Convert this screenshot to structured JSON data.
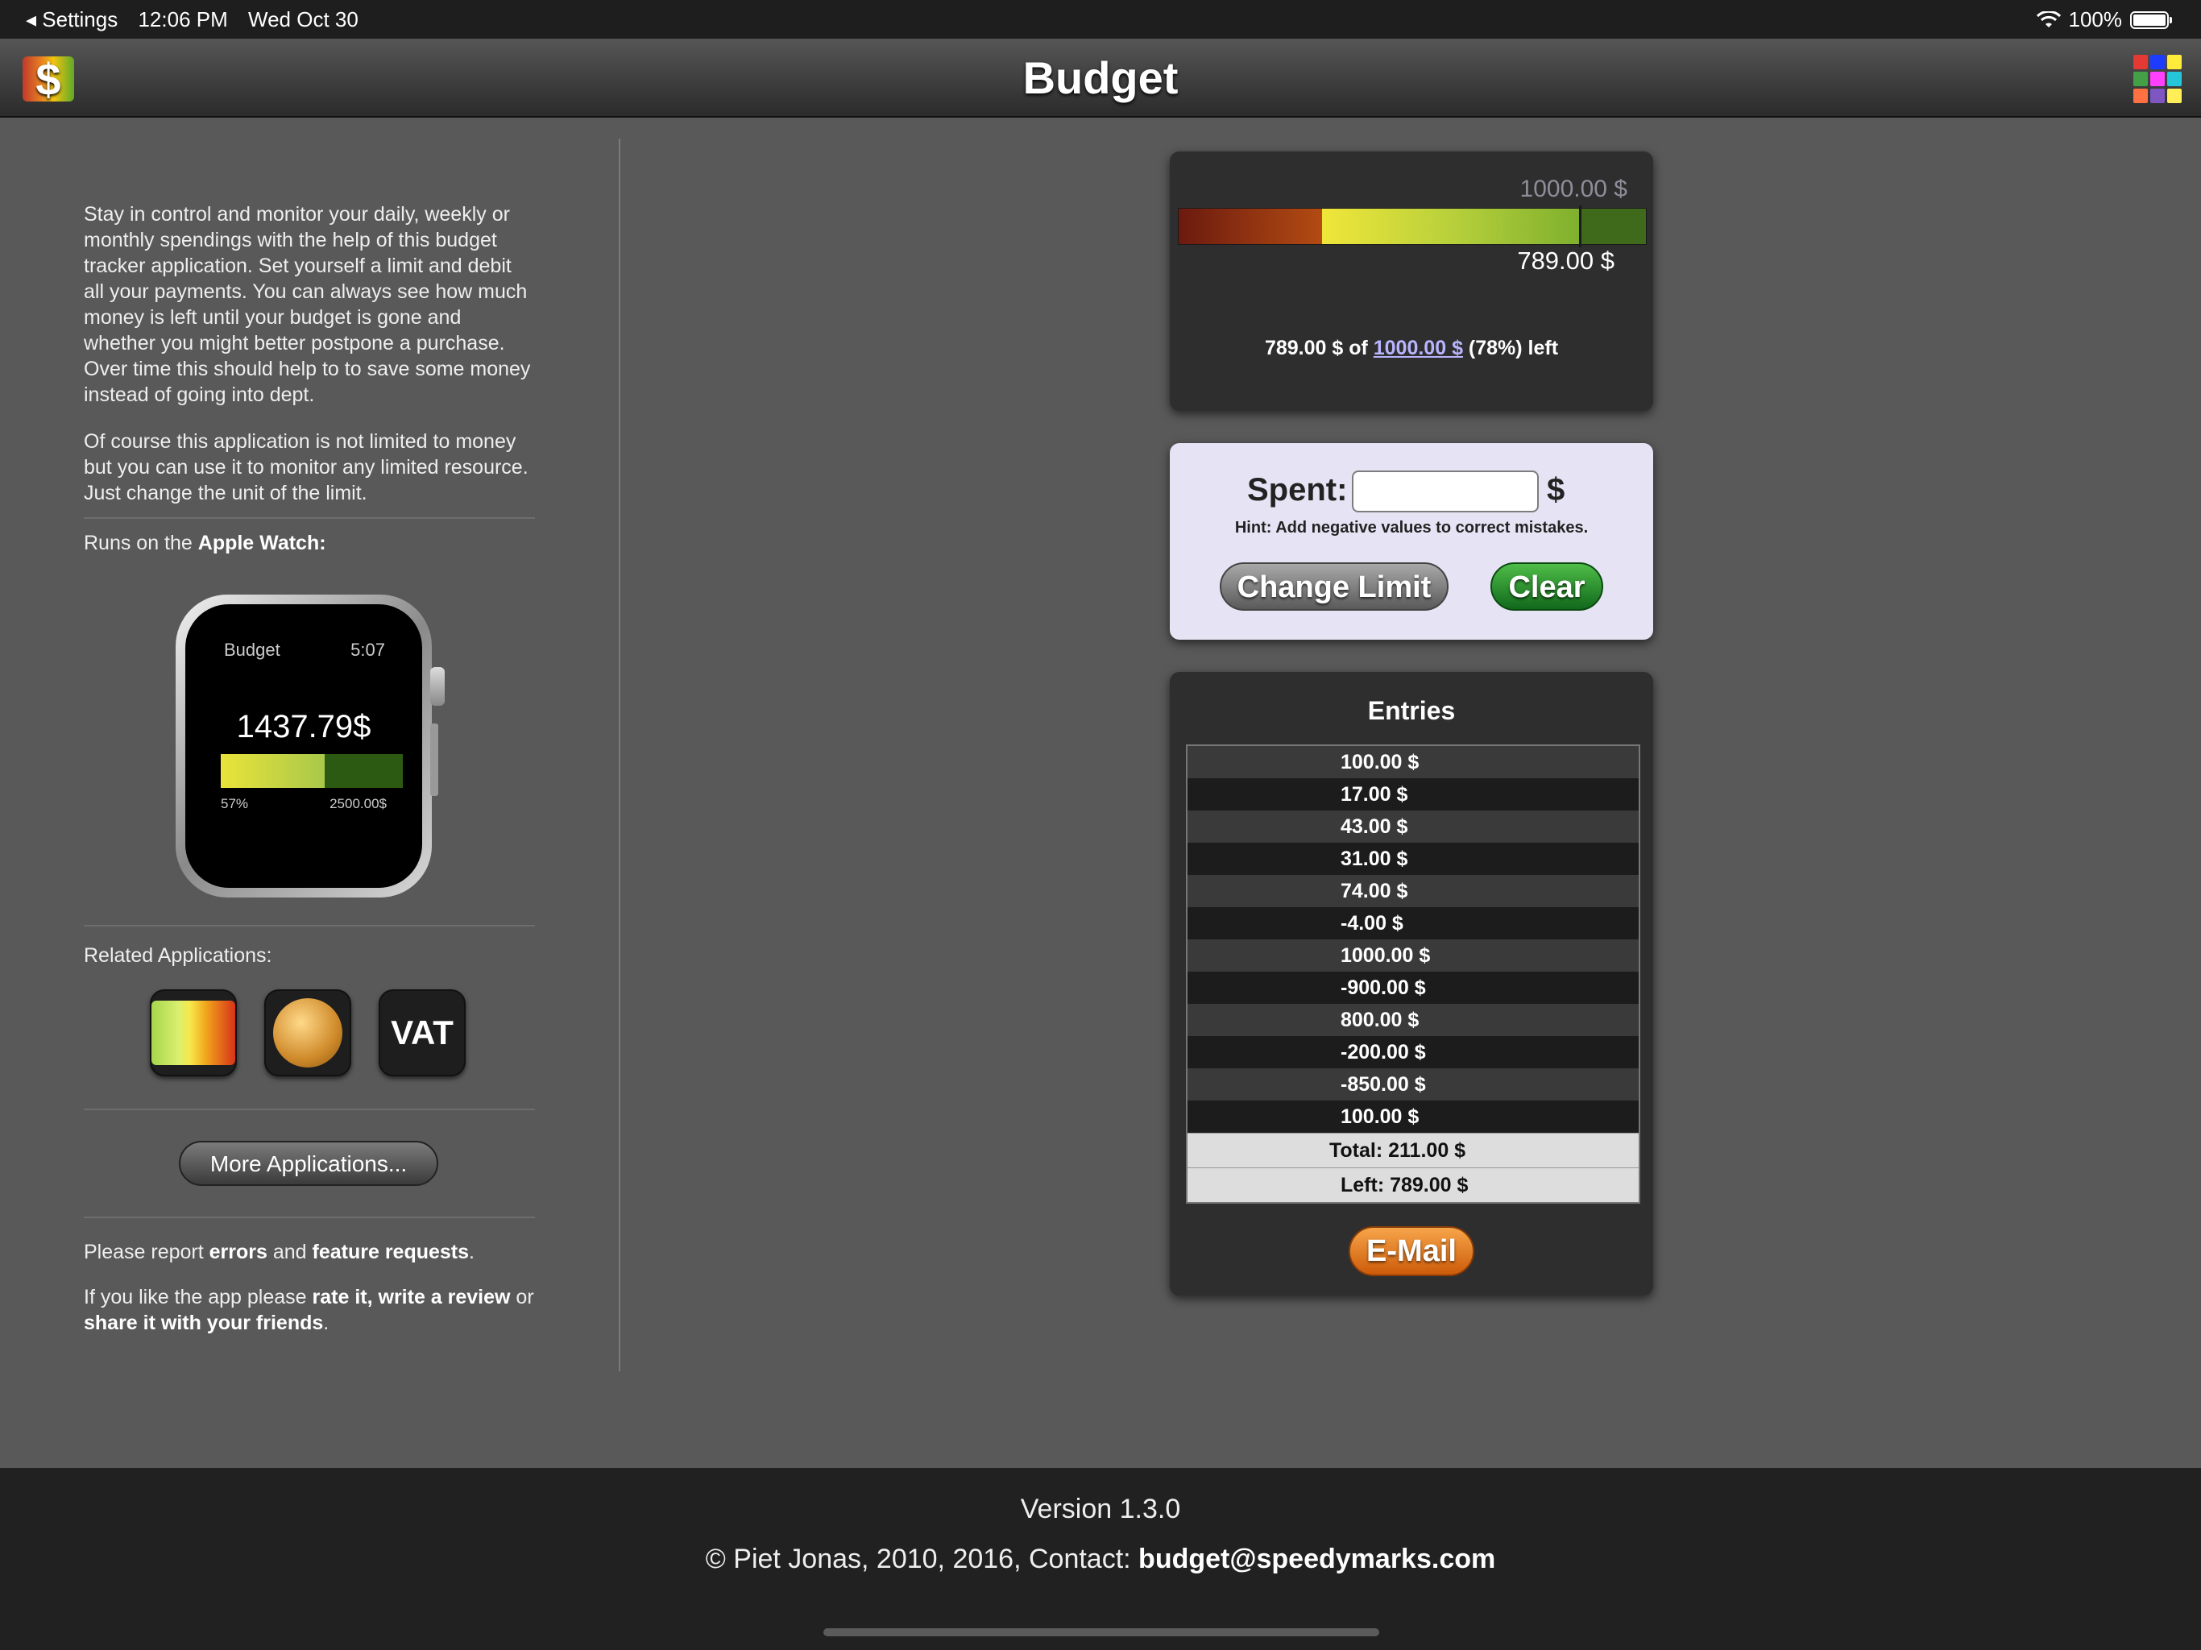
{
  "status_bar": {
    "back_label": "◂ Settings",
    "time": "12:06 PM",
    "date": "Wed Oct 30",
    "battery": "100%"
  },
  "nav": {
    "title": "Budget",
    "app_icon_glyph": "$",
    "grid_colors": [
      "#e53935",
      "#1e3cff",
      "#ffeb3b",
      "#43a047",
      "#ff40ff",
      "#26c6da",
      "#ff7043",
      "#7e57c2",
      "#ffee58"
    ]
  },
  "sidebar": {
    "intro": "Stay in control and monitor your daily, weekly or monthly spendings with the help of this budget tracker application. Set yourself a limit and debit all your payments. You can always see how much money is left until your budget is gone and whether you might better postpone a purchase. Over time this should help to to save some money instead of going into dept.",
    "intro2": "Of course this application is not limited to money but you can use it to monitor any limited resource. Just change the unit of the limit.",
    "runs_on_prefix": "Runs on the ",
    "runs_on_bold": "Apple Watch:",
    "watch": {
      "title": "Budget",
      "time": "5:07",
      "value": "1437.79$",
      "percent": "57%",
      "limit": "2500.00$",
      "fill_fraction": 0.57
    },
    "related_label": "Related Applications:",
    "related_vat": "VAT",
    "more_button": "More Applications...",
    "report": {
      "prefix": "Please report ",
      "errors": "errors",
      "and": " and ",
      "features": "feature requests",
      "suffix": "."
    },
    "rate": {
      "prefix": "If you like the app please ",
      "rate_bold": "rate it, write a review",
      "or": " or ",
      "share_bold": "share it with your friends",
      "suffix": "."
    }
  },
  "limit_panel": {
    "limit": "1000.00 $",
    "remaining": "789.00 $",
    "summary_prefix": "789.00 $ of ",
    "summary_link": "1000.00 $",
    "summary_suffix": " (78%) left"
  },
  "spent_panel": {
    "label": "Spent:",
    "value": "",
    "unit": "$",
    "hint": "Hint: Add negative values to correct mistakes.",
    "change_limit": "Change Limit",
    "clear": "Clear"
  },
  "entries_panel": {
    "title": "Entries",
    "entries": [
      "100.00 $",
      "17.00 $",
      "43.00 $",
      "31.00 $",
      "74.00 $",
      "-4.00 $",
      "1000.00 $",
      "-900.00 $",
      "800.00 $",
      "-200.00 $",
      "-850.00 $",
      "100.00 $"
    ],
    "total": "Total: 211.00 $",
    "left": "Left: 789.00 $",
    "email": "E-Mail"
  },
  "footer": {
    "version": "Version 1.3.0",
    "copyright": "© Piet Jonas, 2010, 2016, Contact: ",
    "email": "budget@speedymarks.com"
  },
  "icons": {
    "back": "chevron-left-icon",
    "wifi": "wifi-icon",
    "battery": "battery-icon",
    "app": "dollar-app-icon",
    "apps": "app-grid-icon"
  }
}
